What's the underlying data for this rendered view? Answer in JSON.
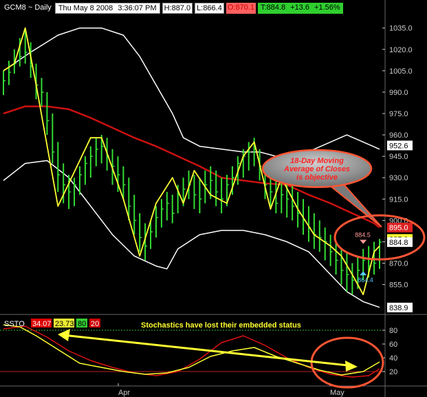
{
  "header": {
    "symbol": "GCM8 ~ Daily",
    "datetime": "Thu May 8 2008",
    "time": "3:36:07 PM",
    "high": "H:887.0",
    "low": "L:866.4",
    "open": "O:870.1",
    "last": "T:884.8",
    "change": "+13.6",
    "pct": "+1.56%"
  },
  "callout": {
    "text": "18-Day Moving Average of Closes is objective"
  },
  "stoch_note": "Stochastics have lost their embedded status",
  "ssto": {
    "label": "SSTO",
    "v1": "34.07",
    "v2": "23.73",
    "v3": "80",
    "v4": "20"
  },
  "colors": {
    "bar": "#33dd33",
    "zigzag": "#ffff33",
    "ma": "#cc1111",
    "band": "#ffffff",
    "stoch_k": "#ffff33",
    "stoch_d": "#dd1111",
    "accent": "#ff5533"
  },
  "chart_data": {
    "type": "bar",
    "price_axis": {
      "ylim": [
        835,
        1045
      ],
      "ticks": [
        "1035.0",
        "1020.0",
        "1005.0",
        "990.0",
        "975.0",
        "960.0",
        "945.0",
        "930.0",
        "915.0",
        "900.0",
        "885.0",
        "870.0",
        "855.0"
      ]
    },
    "price_badges": [
      {
        "label": "952.6",
        "value": 952.6,
        "bg": "#ffffff",
        "fg": "#000000"
      },
      {
        "label": "895.0",
        "value": 895.0,
        "bg": "#dd2222",
        "fg": "#ffffff"
      },
      {
        "label": "887.0",
        "value": 887.0,
        "bg": "#ffff33",
        "fg": "#000000"
      },
      {
        "label": "884.8",
        "value": 884.8,
        "bg": "#ffffff",
        "fg": "#000000"
      },
      {
        "label": "838.9",
        "value": 838.9,
        "bg": "#ffffff",
        "fg": "#000000"
      }
    ],
    "markers": [
      {
        "label": "884.5",
        "value": 884.5,
        "color": "#ff9999",
        "shape": "down"
      },
      {
        "label": "864.4",
        "value": 864.4,
        "color": "#55ccff",
        "shape": "up"
      }
    ],
    "x_labels": [
      "Apr",
      "May"
    ],
    "bars_hlc": [
      [
        1005,
        988,
        998
      ],
      [
        1012,
        995,
        1004
      ],
      [
        1020,
        1003,
        1010
      ],
      [
        1028,
        1008,
        1015
      ],
      [
        1035,
        1010,
        1018
      ],
      [
        1025,
        1000,
        1008
      ],
      [
        1010,
        985,
        995
      ],
      [
        1000,
        980,
        990
      ],
      [
        990,
        960,
        970
      ],
      [
        975,
        940,
        948
      ],
      [
        955,
        920,
        932
      ],
      [
        940,
        912,
        925
      ],
      [
        932,
        908,
        920
      ],
      [
        930,
        910,
        925
      ],
      [
        938,
        918,
        932
      ],
      [
        945,
        925,
        940
      ],
      [
        952,
        930,
        945
      ],
      [
        958,
        938,
        950
      ],
      [
        960,
        940,
        952
      ],
      [
        958,
        935,
        945
      ],
      [
        950,
        925,
        938
      ],
      [
        945,
        920,
        932
      ],
      [
        938,
        915,
        925
      ],
      [
        930,
        900,
        910
      ],
      [
        918,
        890,
        900
      ],
      [
        905,
        878,
        888
      ],
      [
        898,
        872,
        882
      ],
      [
        900,
        880,
        892
      ],
      [
        910,
        888,
        902
      ],
      [
        915,
        895,
        908
      ],
      [
        920,
        900,
        912
      ],
      [
        918,
        898,
        905
      ],
      [
        925,
        905,
        918
      ],
      [
        930,
        910,
        922
      ],
      [
        935,
        915,
        925
      ],
      [
        932,
        908,
        918
      ],
      [
        930,
        905,
        915
      ],
      [
        935,
        912,
        925
      ],
      [
        938,
        915,
        928
      ],
      [
        935,
        910,
        920
      ],
      [
        930,
        905,
        915
      ],
      [
        932,
        910,
        925
      ],
      [
        938,
        918,
        930
      ],
      [
        945,
        925,
        940
      ],
      [
        950,
        930,
        945
      ],
      [
        955,
        935,
        948
      ],
      [
        958,
        938,
        950
      ],
      [
        950,
        928,
        938
      ],
      [
        940,
        915,
        925
      ],
      [
        935,
        910,
        920
      ],
      [
        930,
        905,
        912
      ],
      [
        928,
        905,
        918
      ],
      [
        925,
        902,
        915
      ],
      [
        925,
        900,
        910
      ],
      [
        920,
        895,
        905
      ],
      [
        915,
        890,
        900
      ],
      [
        910,
        885,
        895
      ],
      [
        905,
        880,
        890
      ],
      [
        900,
        878,
        888
      ],
      [
        895,
        872,
        885
      ],
      [
        890,
        868,
        878
      ],
      [
        885,
        862,
        872
      ],
      [
        880,
        855,
        865
      ],
      [
        878,
        850,
        862
      ],
      [
        870,
        848,
        858
      ],
      [
        875,
        852,
        865
      ],
      [
        880,
        858,
        872
      ],
      [
        882,
        860,
        868
      ],
      [
        885,
        862,
        870
      ],
      [
        887,
        866,
        884.8
      ]
    ],
    "zigzag": [
      [
        0,
        1005
      ],
      [
        2,
        1010
      ],
      [
        4,
        1035
      ],
      [
        6,
        995
      ],
      [
        10,
        910
      ],
      [
        16,
        958
      ],
      [
        18,
        958
      ],
      [
        22,
        915
      ],
      [
        25,
        875
      ],
      [
        28,
        912
      ],
      [
        31,
        930
      ],
      [
        33,
        912
      ],
      [
        35,
        935
      ],
      [
        38,
        918
      ],
      [
        41,
        912
      ],
      [
        44,
        945
      ],
      [
        46,
        955
      ],
      [
        49,
        908
      ],
      [
        51,
        930
      ],
      [
        54,
        908
      ],
      [
        57,
        890
      ],
      [
        60,
        882
      ],
      [
        62,
        875
      ],
      [
        64,
        862
      ],
      [
        66,
        848
      ],
      [
        68,
        878
      ],
      [
        69,
        882
      ]
    ],
    "ma18": [
      [
        0,
        975
      ],
      [
        4,
        980
      ],
      [
        8,
        980
      ],
      [
        12,
        978
      ],
      [
        16,
        972
      ],
      [
        20,
        965
      ],
      [
        24,
        958
      ],
      [
        28,
        952
      ],
      [
        32,
        945
      ],
      [
        36,
        938
      ],
      [
        40,
        930
      ],
      [
        44,
        928
      ],
      [
        48,
        926
      ],
      [
        52,
        925
      ],
      [
        56,
        918
      ],
      [
        60,
        912
      ],
      [
        64,
        905
      ],
      [
        68,
        898
      ],
      [
        69,
        895
      ]
    ],
    "band_upper": [
      [
        0,
        1005
      ],
      [
        5,
        1018
      ],
      [
        10,
        1030
      ],
      [
        14,
        1035
      ],
      [
        18,
        1035
      ],
      [
        22,
        1030
      ],
      [
        25,
        1015
      ],
      [
        28,
        995
      ],
      [
        31,
        975
      ],
      [
        33,
        958
      ],
      [
        36,
        952
      ],
      [
        40,
        950
      ],
      [
        44,
        948
      ],
      [
        47,
        948
      ],
      [
        50,
        945
      ],
      [
        54,
        946
      ],
      [
        57,
        950
      ],
      [
        60,
        955
      ],
      [
        63,
        960
      ],
      [
        66,
        955
      ],
      [
        69,
        950
      ]
    ],
    "band_lower": [
      [
        0,
        928
      ],
      [
        4,
        940
      ],
      [
        8,
        942
      ],
      [
        12,
        930
      ],
      [
        16,
        910
      ],
      [
        20,
        890
      ],
      [
        24,
        875
      ],
      [
        28,
        868
      ],
      [
        30,
        866
      ],
      [
        32,
        880
      ],
      [
        36,
        890
      ],
      [
        40,
        893
      ],
      [
        44,
        893
      ],
      [
        48,
        890
      ],
      [
        52,
        885
      ],
      [
        56,
        878
      ],
      [
        60,
        862
      ],
      [
        63,
        850
      ],
      [
        66,
        843
      ],
      [
        69,
        839
      ]
    ],
    "stoch_axis": {
      "ylim": [
        0,
        100
      ],
      "ticks": [
        "80",
        "60",
        "40",
        "20"
      ]
    },
    "stoch_k": [
      [
        0,
        88
      ],
      [
        3,
        85
      ],
      [
        6,
        72
      ],
      [
        10,
        52
      ],
      [
        14,
        32
      ],
      [
        18,
        26
      ],
      [
        22,
        20
      ],
      [
        26,
        16
      ],
      [
        30,
        18
      ],
      [
        34,
        26
      ],
      [
        38,
        42
      ],
      [
        42,
        50
      ],
      [
        46,
        55
      ],
      [
        50,
        42
      ],
      [
        54,
        32
      ],
      [
        58,
        22
      ],
      [
        62,
        15
      ],
      [
        66,
        20
      ],
      [
        69,
        34
      ]
    ],
    "stoch_d": [
      [
        0,
        82
      ],
      [
        4,
        86
      ],
      [
        8,
        70
      ],
      [
        12,
        50
      ],
      [
        16,
        36
      ],
      [
        20,
        26
      ],
      [
        24,
        18
      ],
      [
        28,
        14
      ],
      [
        32,
        20
      ],
      [
        36,
        38
      ],
      [
        40,
        62
      ],
      [
        44,
        72
      ],
      [
        48,
        58
      ],
      [
        52,
        40
      ],
      [
        56,
        26
      ],
      [
        60,
        16
      ],
      [
        64,
        12
      ],
      [
        67,
        14
      ],
      [
        69,
        24
      ]
    ]
  }
}
